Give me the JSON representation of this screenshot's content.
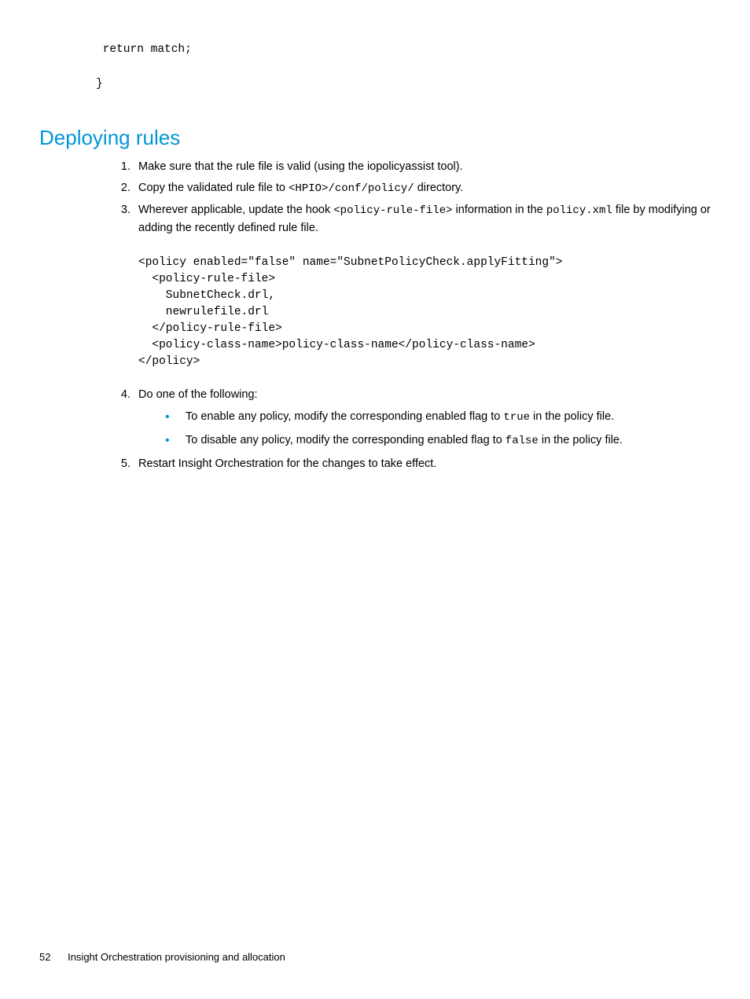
{
  "topcode": {
    "line1": " return match;",
    "line2": "}"
  },
  "heading": "Deploying rules",
  "steps": {
    "s1": {
      "num": "1.",
      "pre": "Make sure that the rule file is valid (using the iopolicyassist tool)."
    },
    "s2": {
      "num": "2.",
      "pre": "Copy the validated rule file to ",
      "c1": "<HPIO>/conf/policy/",
      "post": " directory."
    },
    "s3": {
      "num": "3.",
      "pre": "Wherever applicable, update the hook ",
      "c1": "<policy-rule-file>",
      "mid": " information in the ",
      "c2": "policy.xml",
      "post": " file by modifying or adding the recently defined rule file."
    },
    "s4": {
      "num": "4.",
      "text": "Do one of the following:"
    },
    "s5": {
      "num": "5.",
      "text": "Restart Insight Orchestration for the changes to take effect."
    }
  },
  "xmlblock": "<policy enabled=\"false\" name=\"SubnetPolicyCheck.applyFitting\">\n  <policy-rule-file>\n    SubnetCheck.drl,\n    newrulefile.drl\n  </policy-rule-file>\n  <policy-class-name>policy-class-name</policy-class-name>\n</policy>",
  "bullets": {
    "b1": {
      "pre": "To enable any policy, modify the corresponding enabled flag to ",
      "c1": "true",
      "post": " in the policy file."
    },
    "b2": {
      "pre": "To disable any policy, modify the corresponding enabled flag to ",
      "c1": "false",
      "post": " in the policy file."
    }
  },
  "footer": {
    "pagenum": "52",
    "title": "Insight Orchestration provisioning and allocation"
  }
}
